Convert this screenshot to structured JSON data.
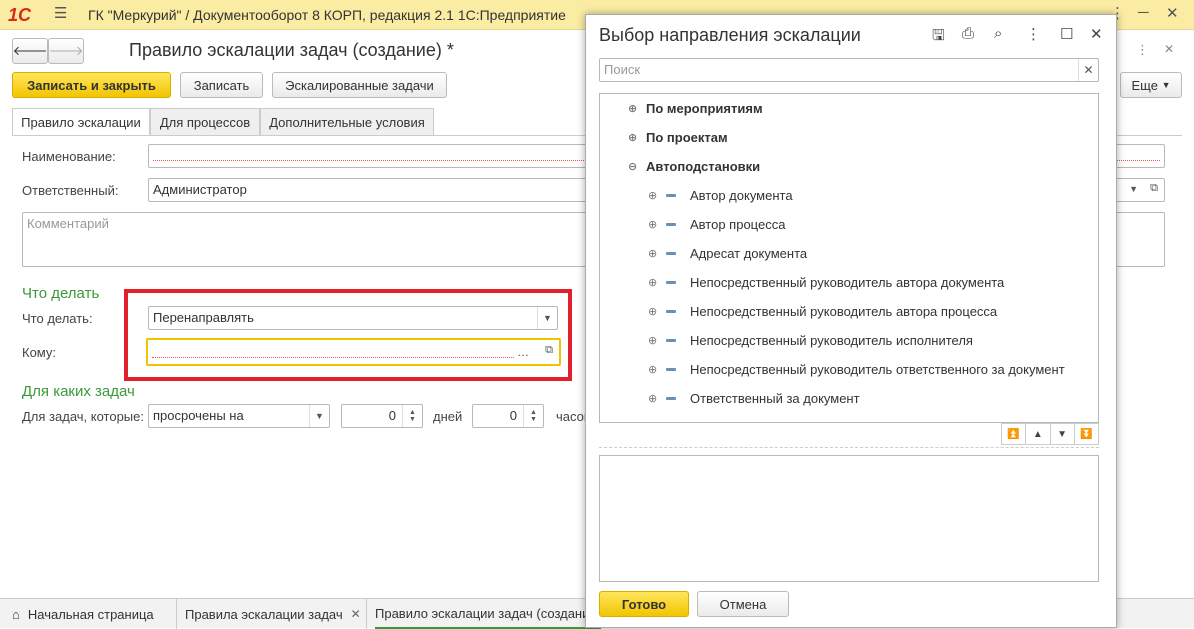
{
  "titlebar": {
    "logo": "1С",
    "title": "ГК \"Меркурий\" / Документооборот 8 КОРП, редакция 2.1 1С:Предприятие"
  },
  "form": {
    "title": "Правило эскалации задач (создание) *",
    "buttons": {
      "save_close": "Записать и закрыть",
      "save": "Записать",
      "escalated": "Эскалированные задачи",
      "more": "Еще"
    },
    "tabs": [
      "Правило эскалации",
      "Для процессов",
      "Дополнительные условия"
    ],
    "fields": {
      "name_label": "Наименование:",
      "name_value": "",
      "responsible_label": "Ответственный:",
      "responsible_value": "Администратор",
      "comment_placeholder": "Комментарий"
    },
    "what_section": "Что делать",
    "what_label": "Что делать:",
    "what_value": "Перенаправлять",
    "to_label": "Кому:",
    "to_value": "",
    "which_section": "Для каких задач",
    "tasks_label": "Для задач, которые:",
    "tasks_value": "просрочены на",
    "days_value": "0",
    "days_label": "дней",
    "hours_value": "0",
    "hours_label": "часов"
  },
  "dialog": {
    "title": "Выбор направления эскалации",
    "search_placeholder": "Поиск",
    "tree": [
      {
        "label": "По мероприятиям",
        "level": 0,
        "expander": "⊕",
        "bold": true
      },
      {
        "label": "По проектам",
        "level": 0,
        "expander": "⊕",
        "bold": true
      },
      {
        "label": "Автоподстановки",
        "level": 0,
        "expander": "⊖",
        "bold": true
      },
      {
        "label": "Автор документа",
        "level": 1,
        "expander": "⊕",
        "bold": false
      },
      {
        "label": "Автор процесса",
        "level": 1,
        "expander": "⊕",
        "bold": false
      },
      {
        "label": "Адресат документа",
        "level": 1,
        "expander": "⊕",
        "bold": false
      },
      {
        "label": "Непосредственный руководитель автора документа",
        "level": 1,
        "expander": "⊕",
        "bold": false
      },
      {
        "label": "Непосредственный руководитель автора процесса",
        "level": 1,
        "expander": "⊕",
        "bold": false
      },
      {
        "label": "Непосредственный руководитель исполнителя",
        "level": 1,
        "expander": "⊕",
        "bold": false
      },
      {
        "label": "Непосредственный руководитель ответственного за документ",
        "level": 1,
        "expander": "⊕",
        "bold": false
      },
      {
        "label": "Ответственный за документ",
        "level": 1,
        "expander": "⊕",
        "bold": false
      }
    ],
    "ok": "Готово",
    "cancel": "Отмена"
  },
  "statusbar": {
    "home": "Начальная страница",
    "tab1": "Правила эскалации задач",
    "tab2": "Правило эскалации задач (создание)"
  },
  "colors": {
    "accent_yellow": "#f2c500",
    "section_green": "#3a9a3a",
    "highlight_red": "#e0202a"
  }
}
